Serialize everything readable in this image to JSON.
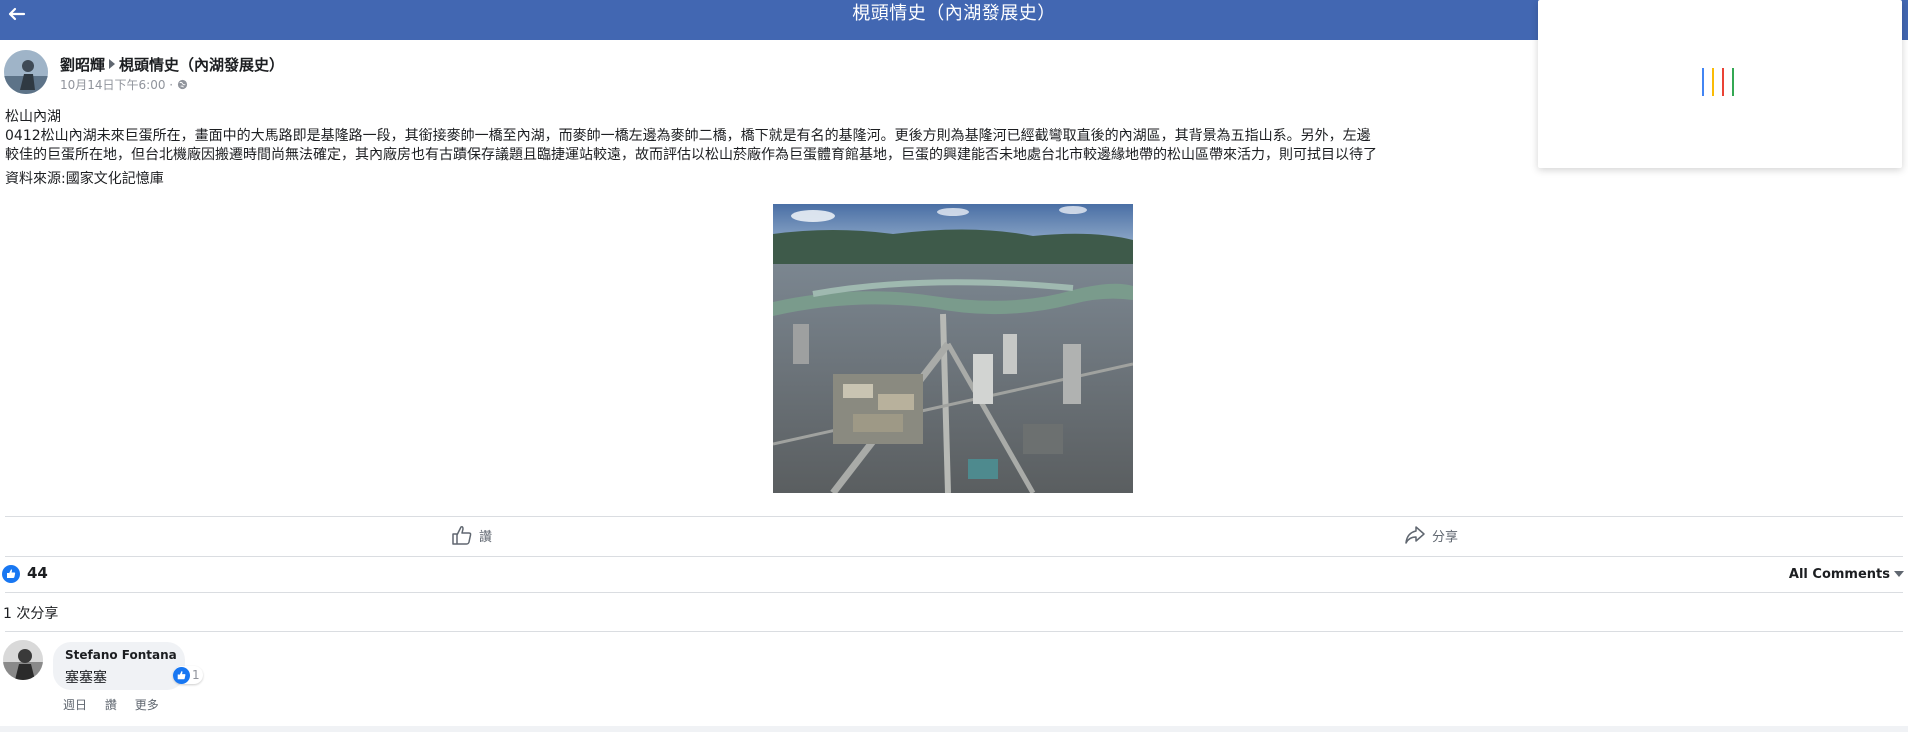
{
  "topbar": {
    "title": "梘頭情史（內湖發展史）",
    "background": "#4267b2",
    "back_icon": "arrow-left-icon"
  },
  "post": {
    "author": "劉昭輝",
    "group": "梘頭情史（內湖發展史）",
    "time": "10月14日下午6:00 · ",
    "privacy_icon": "globe-icon",
    "title": "松山內湖",
    "line1": "0412松山內湖未來巨蛋所在，畫面中的大馬路即是基隆路一段，其銜接麥帥一橋至內湖，而麥帥一橋左邊為麥帥二橋，橋下就是有名的基隆河。更後方則為基隆河已經截彎取直後的內湖區，其背景為五指山系。另外，左邊",
    "line2": "較佳的巨蛋所在地，但台北機廠因搬遷時間尚無法確定，其內廠房也有古蹟保存議題且臨捷運站較遠，故而評估以松山菸廠作為巨蛋體育館基地，巨蛋的興建能否未地處台北市較邊緣地帶的松山區帶來活力，則可拭目以待了",
    "source": "資料來源:國家文化記憶庫"
  },
  "actions": {
    "like_label": "讚",
    "like_icon": "thumbs-up-icon",
    "share_label": "分享",
    "share_icon": "share-arrow-icon"
  },
  "summary": {
    "like_count": "44",
    "all_comments": "All Comments",
    "shares": "1 次分享",
    "accent": "#1877f2"
  },
  "comment": {
    "name": "Stefano Fontana",
    "text": "塞塞塞",
    "reaction_count": "1",
    "time": "週日",
    "like": "讚",
    "more": "更多"
  },
  "loader_colors": [
    "#4285f4",
    "#fbbc05",
    "#ea4335",
    "#34a853"
  ]
}
